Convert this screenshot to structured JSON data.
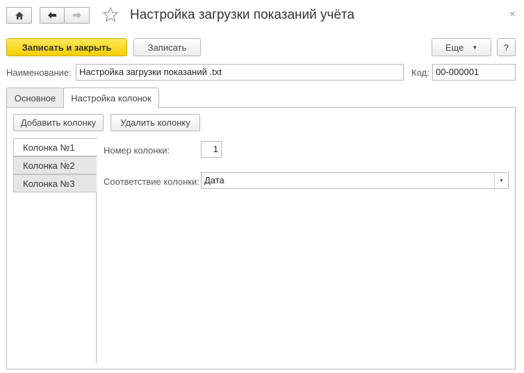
{
  "window": {
    "title": "Настройка загрузки показаний учёта",
    "close_glyph": "×"
  },
  "nav": {
    "home_icon": "home-icon",
    "back_icon": "arrow-left-icon",
    "forward_icon": "arrow-right-icon",
    "favorite_icon": "star-icon"
  },
  "toolbar": {
    "save_close_label": "Записать и закрыть",
    "save_label": "Записать",
    "more_label": "Еще",
    "more_caret": "▼",
    "help_label": "?"
  },
  "form": {
    "name_label": "Наименование:",
    "name_value": "Настройка загрузки показаний .txt",
    "code_label": "Код:",
    "code_value": "00-000001"
  },
  "tabs": [
    {
      "label": "Основное",
      "active": false
    },
    {
      "label": "Настройка колонок",
      "active": true
    }
  ],
  "columns_panel": {
    "add_label": "Добавить колонку",
    "delete_label": "Удалить колонку",
    "items": [
      {
        "label": "Колонка №1",
        "active": true
      },
      {
        "label": "Колонка №2",
        "active": false
      },
      {
        "label": "Колонка №3",
        "active": false
      }
    ],
    "number_label": "Номер колонки:",
    "number_value": "1",
    "mapping_label": "Соответствие колонки:",
    "mapping_value": "Дата",
    "mapping_caret": "▼"
  },
  "colors": {
    "primary_button": "#f5cf00",
    "border": "#b8b8b8",
    "inactive_tab": "#ececec"
  }
}
